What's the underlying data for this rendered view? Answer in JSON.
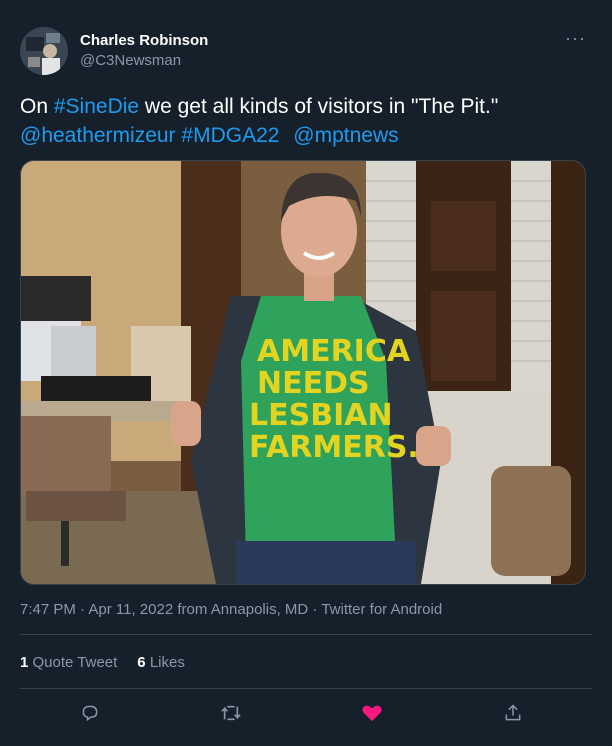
{
  "author": {
    "display_name": "Charles Robinson",
    "handle": "@C3Newsman"
  },
  "more_label": "···",
  "tweet": {
    "text_prefix": "On ",
    "hashtag_sinedie": "#SineDie",
    "text_middle": " we get all kinds of visitors in \"The Pit.\"",
    "mention_heather": "@heathermizeur",
    "hashtag_mdga": "#MDGA22",
    "mention_mpt": "@mptnews"
  },
  "photo": {
    "shirt_lines": [
      "AMERICA",
      "NEEDS",
      "LESBIAN",
      "FARMERS."
    ]
  },
  "meta": {
    "time": "7:47 PM",
    "separator1": " · ",
    "date": "Apr 11, 2022",
    "from_text": " from ",
    "location": "Annapolis, MD",
    "separator2": " · ",
    "client": "Twitter for Android"
  },
  "stats": {
    "quote_count": "1",
    "quote_label": "Quote Tweet",
    "like_count": "6",
    "like_label": "Likes"
  },
  "icons": {
    "reply": "reply-icon",
    "retweet": "retweet-icon",
    "like": "heart-icon",
    "share": "share-icon"
  },
  "colors": {
    "background": "#15202b",
    "link": "#1d9bf0",
    "muted": "#8b98a5",
    "like": "#f91880"
  }
}
